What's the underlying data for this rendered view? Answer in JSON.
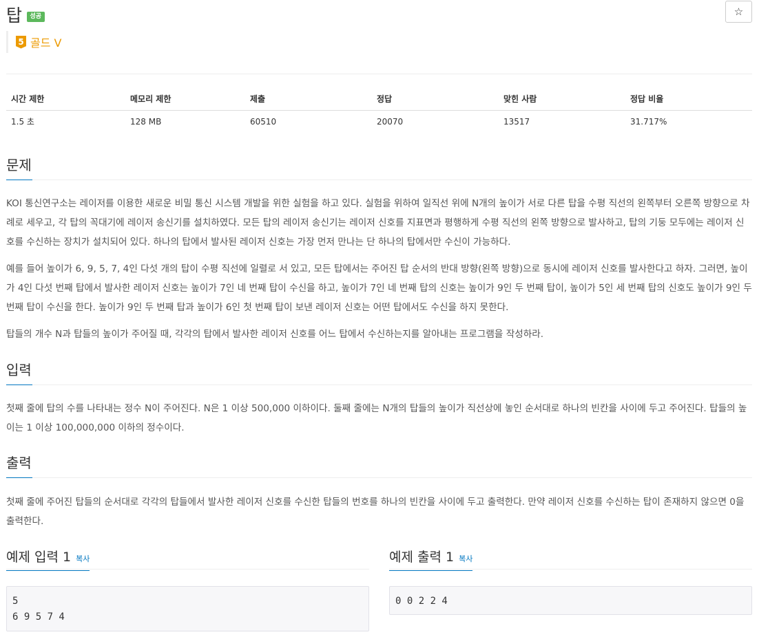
{
  "header": {
    "title": "탑",
    "status_badge": "성공",
    "star_glyph": "☆",
    "tier_number": "5",
    "tier_label": "골드 V",
    "tier_color": "#ec9a00"
  },
  "info_table": {
    "headers": [
      "시간 제한",
      "메모리 제한",
      "제출",
      "정답",
      "맞힌 사람",
      "정답 비율"
    ],
    "values": [
      "1.5 초",
      "128 MB",
      "60510",
      "20070",
      "13517",
      "31.717%"
    ]
  },
  "problem": {
    "heading": "문제",
    "paragraphs": [
      "KOI 통신연구소는 레이저를 이용한 새로운 비밀 통신 시스템 개발을 위한 실험을 하고 있다. 실험을 위하여 일직선 위에 N개의 높이가 서로 다른 탑을 수평 직선의 왼쪽부터 오른쪽 방향으로 차례로 세우고, 각 탑의 꼭대기에 레이저 송신기를 설치하였다. 모든 탑의 레이저 송신기는 레이저 신호를 지표면과 평행하게 수평 직선의 왼쪽 방향으로 발사하고, 탑의 기둥 모두에는 레이저 신호를 수신하는 장치가 설치되어 있다. 하나의 탑에서 발사된 레이저 신호는 가장 먼저 만나는 단 하나의 탑에서만 수신이 가능하다.",
      "예를 들어 높이가 6, 9, 5, 7, 4인 다섯 개의 탑이 수평 직선에 일렬로 서 있고, 모든 탑에서는 주어진 탑 순서의 반대 방향(왼쪽 방향)으로 동시에 레이저 신호를 발사한다고 하자. 그러면, 높이가 4인 다섯 번째 탑에서 발사한 레이저 신호는 높이가 7인 네 번째 탑이 수신을 하고, 높이가 7인 네 번째 탑의 신호는 높이가 9인 두 번째 탑이, 높이가 5인 세 번째 탑의 신호도 높이가 9인 두 번째 탑이 수신을 한다. 높이가 9인 두 번째 탑과 높이가 6인 첫 번째 탑이 보낸 레이저 신호는 어떤 탑에서도 수신을 하지 못한다.",
      "탑들의 개수 N과 탑들의 높이가 주어질 때, 각각의 탑에서 발사한 레이저 신호를 어느 탑에서 수신하는지를 알아내는 프로그램을 작성하라."
    ]
  },
  "input": {
    "heading": "입력",
    "text": "첫째 줄에 탑의 수를 나타내는 정수 N이 주어진다. N은 1 이상 500,000 이하이다. 둘째 줄에는 N개의 탑들의 높이가 직선상에 놓인 순서대로 하나의 빈칸을 사이에 두고 주어진다. 탑들의 높이는 1 이상 100,000,000 이하의 정수이다."
  },
  "output": {
    "heading": "출력",
    "text": "첫째 줄에 주어진 탑들의 순서대로 각각의 탑들에서 발사한 레이저 신호를 수신한 탑들의 번호를 하나의 빈칸을 사이에 두고 출력한다. 만약 레이저 신호를 수신하는 탑이 존재하지 않으면 0을 출력한다."
  },
  "samples": {
    "input_heading": "예제 입력 1",
    "output_heading": "예제 출력 1",
    "copy_label": "복사",
    "input_text": "5\n6 9 5 7 4",
    "output_text": "0 0 2 2 4"
  }
}
